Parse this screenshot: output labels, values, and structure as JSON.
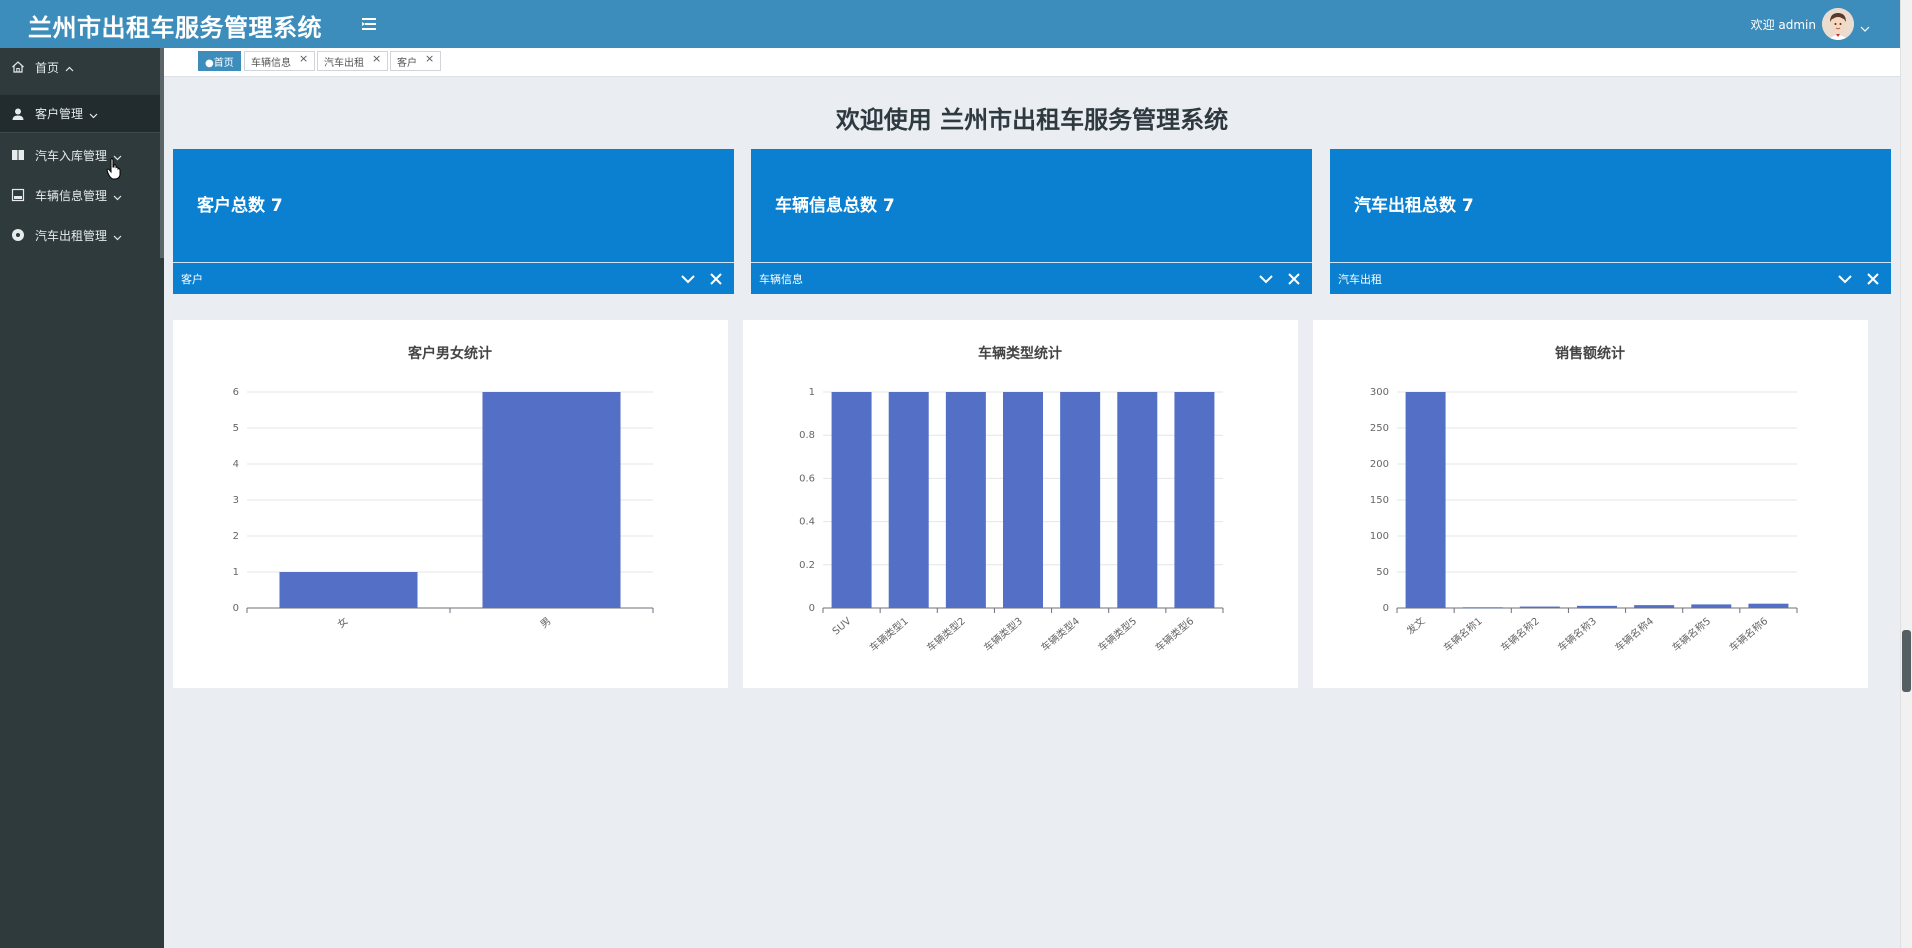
{
  "header": {
    "title": "兰州市出租车服务管理系统",
    "welcome": "欢迎 admin"
  },
  "sidebar": {
    "items": [
      {
        "label": "首页",
        "icon": "home-icon"
      },
      {
        "label": "客户管理",
        "icon": "user-icon"
      },
      {
        "label": "汽车入库管理",
        "icon": "columns-icon"
      },
      {
        "label": "车辆信息管理",
        "icon": "image-icon"
      },
      {
        "label": "汽车出租管理",
        "icon": "circle-icon"
      }
    ]
  },
  "tabs": [
    {
      "label": "●首页",
      "active": true
    },
    {
      "label": "车辆信息",
      "close": "×"
    },
    {
      "label": "汽车出租",
      "close": "×"
    },
    {
      "label": "客户",
      "close": "×"
    }
  ],
  "main": {
    "heading": "欢迎使用 兰州市出租车服务管理系统"
  },
  "stats": [
    {
      "label": "客户总数",
      "value": "7",
      "footer": "客户"
    },
    {
      "label": "车辆信息总数",
      "value": "7",
      "footer": "车辆信息"
    },
    {
      "label": "汽车出租总数",
      "value": "7",
      "footer": "汽车出租"
    }
  ],
  "colors": {
    "header": "#3c8dbc",
    "sidebar": "#2f3a3d",
    "card": "#0b80d0",
    "bar": "#5470c6"
  },
  "chart_data": [
    {
      "type": "bar",
      "title": "客户男女统计",
      "categories": [
        "女",
        "男"
      ],
      "values": [
        1,
        6
      ],
      "ylim": [
        0,
        6
      ],
      "yticks": [
        "0",
        "1",
        "2",
        "3",
        "4",
        "5",
        "6"
      ],
      "grid": true
    },
    {
      "type": "bar",
      "title": "车辆类型统计",
      "categories": [
        "SUV",
        "车辆类型1",
        "车辆类型2",
        "车辆类型3",
        "车辆类型4",
        "车辆类型5",
        "车辆类型6"
      ],
      "values": [
        1,
        1,
        1,
        1,
        1,
        1,
        1
      ],
      "ylim": [
        0,
        1
      ],
      "yticks": [
        "0",
        "0.2",
        "0.4",
        "0.6",
        "0.8",
        "1"
      ],
      "grid": true
    },
    {
      "type": "bar",
      "title": "销售额统计",
      "categories": [
        "发文",
        "车辆名称1",
        "车辆名称2",
        "车辆名称3",
        "车辆名称4",
        "车辆名称5",
        "车辆名称6"
      ],
      "values": [
        300,
        1,
        2,
        3,
        4,
        5,
        6
      ],
      "ylim": [
        0,
        300
      ],
      "yticks": [
        "0",
        "50",
        "100",
        "150",
        "200",
        "250",
        "300"
      ],
      "grid": true
    }
  ]
}
